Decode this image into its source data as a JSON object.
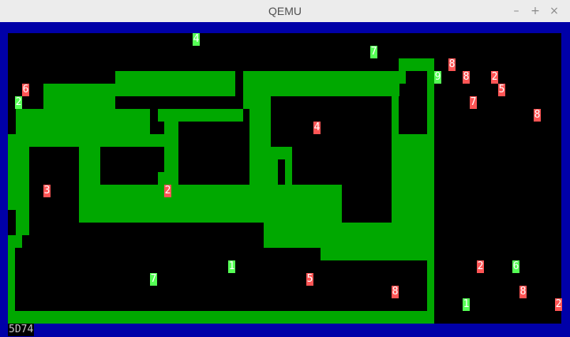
{
  "window": {
    "title": "QEMU",
    "minimize": "–",
    "maximize": "+",
    "close": "×"
  },
  "colors": {
    "background": "#000000",
    "wall": "#00a800",
    "border": "#0000a8",
    "red_tile": "#ff5555",
    "green_tile": "#55ff55"
  },
  "status_text": "5D74",
  "tiles": [
    {
      "v": "4",
      "c": "green"
    },
    {
      "v": "7",
      "c": "green"
    },
    {
      "v": "8",
      "c": "red"
    },
    {
      "v": "9",
      "c": "green"
    },
    {
      "v": "8",
      "c": "red"
    },
    {
      "v": "2",
      "c": "red"
    },
    {
      "v": "6",
      "c": "red"
    },
    {
      "v": "5",
      "c": "red"
    },
    {
      "v": "2",
      "c": "green"
    },
    {
      "v": "7",
      "c": "red"
    },
    {
      "v": "8",
      "c": "red"
    },
    {
      "v": "4",
      "c": "red"
    },
    {
      "v": "3",
      "c": "red"
    },
    {
      "v": "2",
      "c": "red"
    },
    {
      "v": "1",
      "c": "green"
    },
    {
      "v": "2",
      "c": "red"
    },
    {
      "v": "6",
      "c": "green"
    },
    {
      "v": "7",
      "c": "green"
    },
    {
      "v": "5",
      "c": "red"
    },
    {
      "v": "8",
      "c": "red"
    },
    {
      "v": "8",
      "c": "red"
    },
    {
      "v": "1",
      "c": "green"
    },
    {
      "v": "2",
      "c": "red"
    }
  ]
}
